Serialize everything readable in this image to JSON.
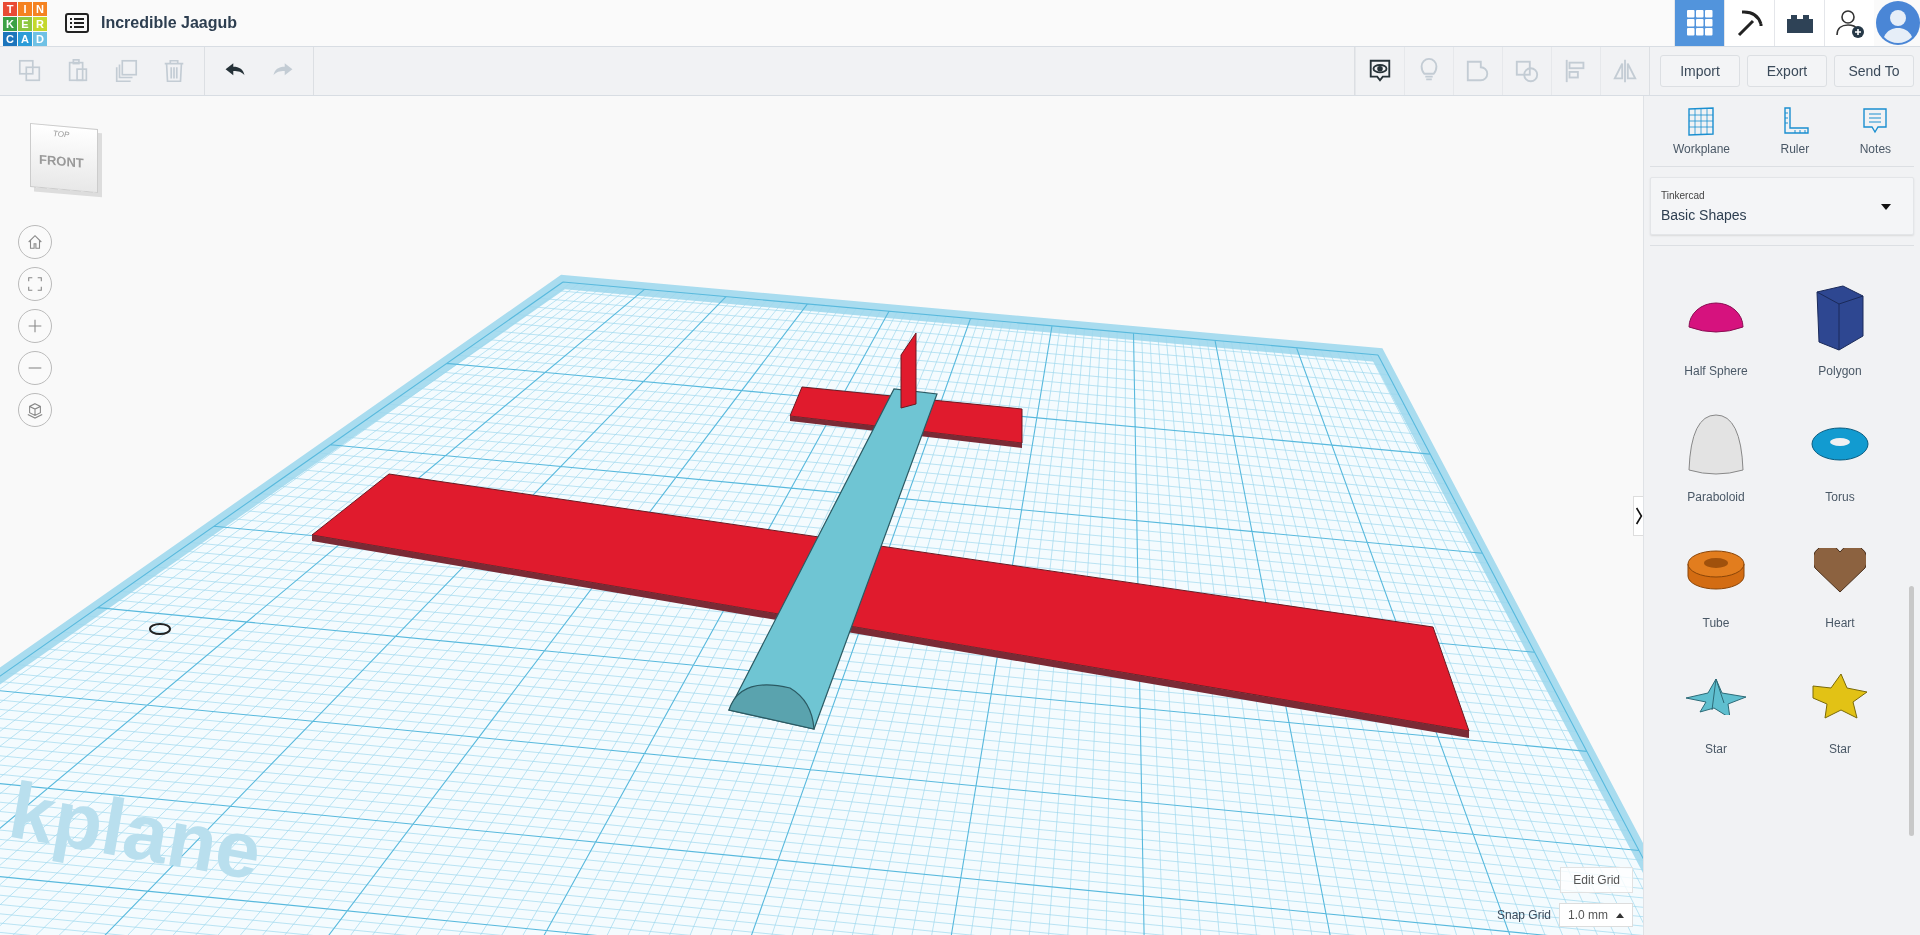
{
  "app": {
    "logo_letters": [
      "T",
      "I",
      "N",
      "K",
      "E",
      "R",
      "C",
      "A",
      "D"
    ],
    "design_title": "Incredible Jaagub"
  },
  "top_nav": [
    {
      "kind": "grid",
      "selected": true
    },
    {
      "kind": "pickaxe",
      "selected": false
    },
    {
      "kind": "bricks",
      "selected": false
    },
    {
      "kind": "add_user",
      "selected": false
    }
  ],
  "toolbar": {
    "edit_tools": [
      {
        "kind": "copy",
        "disabled": true
      },
      {
        "kind": "paste",
        "disabled": true
      },
      {
        "kind": "duplicate",
        "disabled": true
      },
      {
        "kind": "delete",
        "disabled": true
      }
    ],
    "history_tools": [
      {
        "kind": "undo",
        "disabled": false
      },
      {
        "kind": "redo",
        "disabled": true
      }
    ],
    "view_tools": [
      {
        "kind": "notes_eye",
        "disabled": false
      },
      {
        "kind": "bulb",
        "disabled": true
      },
      {
        "kind": "group",
        "disabled": true
      },
      {
        "kind": "ungroup",
        "disabled": true
      },
      {
        "kind": "align",
        "disabled": true
      },
      {
        "kind": "mirror",
        "disabled": true
      }
    ],
    "actions": [
      "Import",
      "Export",
      "Send To"
    ]
  },
  "view_cube": {
    "top": "TOP",
    "front": "FRONT"
  },
  "nav_controls": [
    {
      "kind": "home"
    },
    {
      "kind": "fit"
    },
    {
      "kind": "zoom_in"
    },
    {
      "kind": "zoom_out"
    },
    {
      "kind": "perspective"
    }
  ],
  "workplane": {
    "label": "kplane"
  },
  "grid_controls": {
    "edit_button": "Edit Grid",
    "snap_label": "Snap Grid",
    "snap_value": "1.0 mm"
  },
  "panel": {
    "tools": [
      {
        "kind": "workplane",
        "label": "Workplane"
      },
      {
        "kind": "ruler",
        "label": "Ruler"
      },
      {
        "kind": "notes",
        "label": "Notes"
      }
    ],
    "library": {
      "source": "Tinkercad",
      "category": "Basic Shapes"
    },
    "shapes": [
      {
        "kind": "half_sphere",
        "label": "Half Sphere"
      },
      {
        "kind": "polygon",
        "label": "Polygon"
      },
      {
        "kind": "paraboloid",
        "label": "Paraboloid"
      },
      {
        "kind": "torus",
        "label": "Torus"
      },
      {
        "kind": "tube",
        "label": "Tube"
      },
      {
        "kind": "heart",
        "label": "Heart"
      },
      {
        "kind": "star_pyramid",
        "label": "Star"
      },
      {
        "kind": "star",
        "label": "Star"
      }
    ]
  }
}
